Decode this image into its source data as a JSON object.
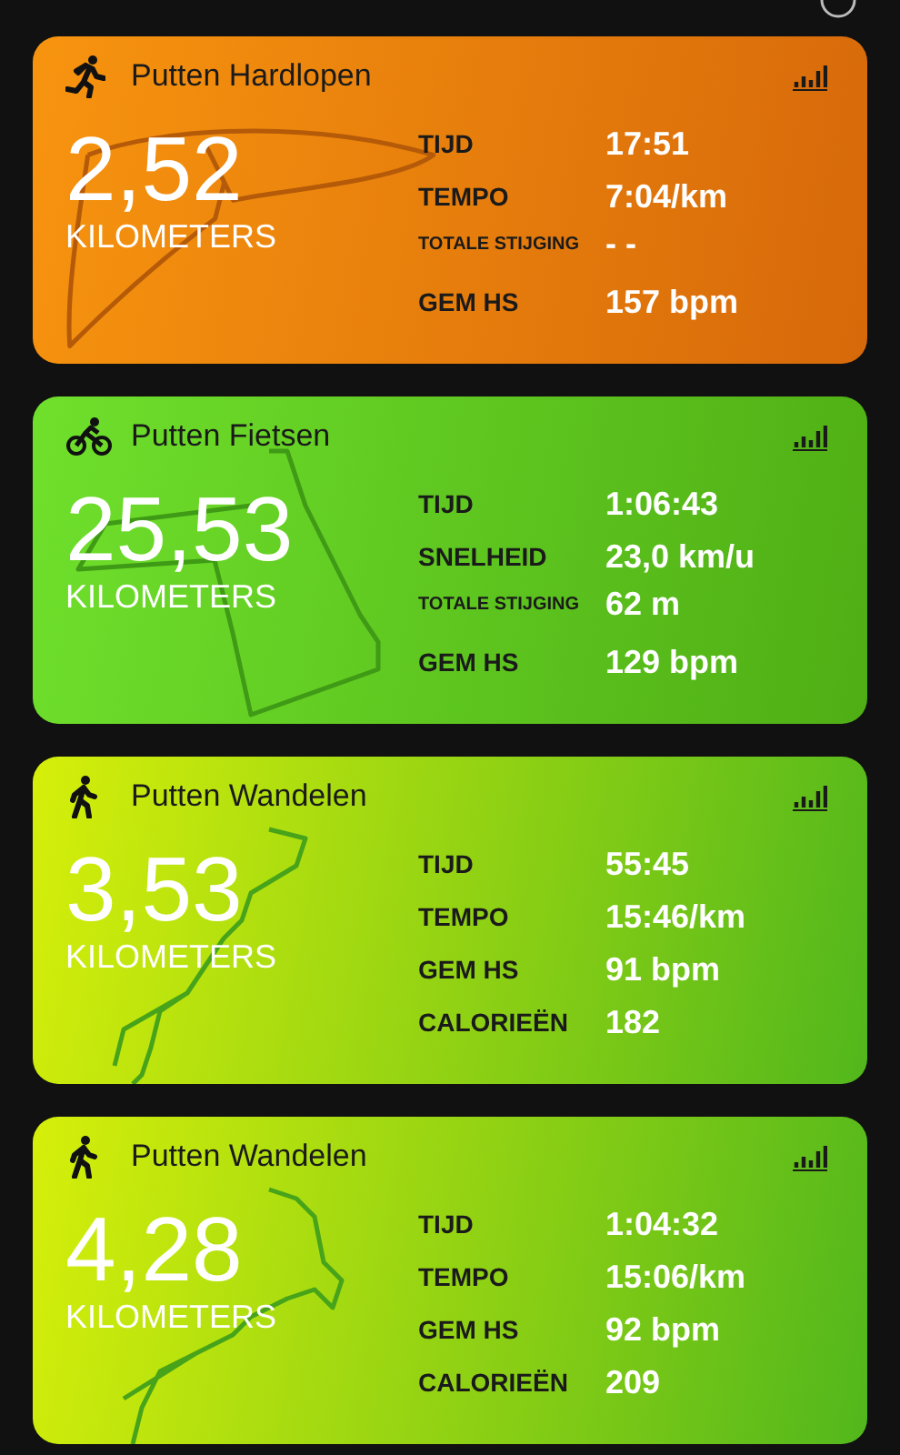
{
  "activities": [
    {
      "kind": "run",
      "title": "Putten Hardlopen",
      "distance": "2,52",
      "unit": "KILOMETERS",
      "stats": [
        {
          "label": "TIJD",
          "value": "17:51"
        },
        {
          "label": "TEMPO",
          "value": "7:04/km"
        },
        {
          "label": "TOTALE STIJGING",
          "value": "- -",
          "kind": "small"
        },
        {
          "label": "GEM HS",
          "value": "157 bpm"
        }
      ]
    },
    {
      "kind": "bike",
      "title": "Putten Fietsen",
      "distance": "25,53",
      "unit": "KILOMETERS",
      "stats": [
        {
          "label": "TIJD",
          "value": "1:06:43"
        },
        {
          "label": "SNELHEID",
          "value": "23,0 km/u"
        },
        {
          "label": "TOTALE STIJGING",
          "value": "62 m",
          "kind": "small"
        },
        {
          "label": "GEM HS",
          "value": "129 bpm"
        }
      ]
    },
    {
      "kind": "walk",
      "title": "Putten Wandelen",
      "distance": "3,53",
      "unit": "KILOMETERS",
      "stats": [
        {
          "label": "TIJD",
          "value": "55:45"
        },
        {
          "label": "TEMPO",
          "value": "15:46/km"
        },
        {
          "label": "GEM HS",
          "value": "91 bpm"
        },
        {
          "label": "CALORIEËN",
          "value": "182"
        }
      ]
    },
    {
      "kind": "walk",
      "title": "Putten Wandelen",
      "distance": "4,28",
      "unit": "KILOMETERS",
      "stats": [
        {
          "label": "TIJD",
          "value": "1:04:32"
        },
        {
          "label": "TEMPO",
          "value": "15:06/km"
        },
        {
          "label": "GEM HS",
          "value": "92 bpm"
        },
        {
          "label": "CALORIEËN",
          "value": "209"
        }
      ]
    }
  ]
}
